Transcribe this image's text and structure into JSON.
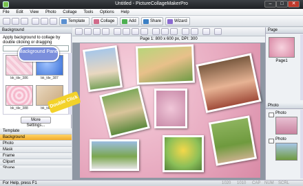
{
  "window": {
    "title": "Untitled - PictureCollageMakerPro",
    "min": "–",
    "max": "□",
    "close": "✕"
  },
  "menu": [
    "File",
    "Edit",
    "View",
    "Photo",
    "Collage",
    "Tools",
    "Options",
    "Help"
  ],
  "toolbar": {
    "template": "Template",
    "collage": "Collage",
    "add": "Add",
    "share": "Share",
    "wizard": "Wizard"
  },
  "left_panel": {
    "title": "Background",
    "description": "Apply background to collage by double clicking or dragging",
    "tiles": [
      "bk_tile_386",
      "bk_tile_387",
      "bk_tile_388",
      "bk_tile_389"
    ],
    "more_button": "More Settings...",
    "categories": [
      "Template",
      "Background",
      "Photo",
      "Mask",
      "Frame",
      "Clipart",
      "Shape"
    ],
    "selected_category": "Background"
  },
  "callouts": {
    "pane": "Background Pane",
    "double_click": "Double Click"
  },
  "canvas": {
    "info": "Page 1: 800 x 600 px, DPI: 300"
  },
  "right_panel": {
    "pages_title": "Page",
    "page_label": "Page1",
    "photos_title": "Photo",
    "photo_items": [
      "Photo",
      "Photo"
    ]
  },
  "status": {
    "text": "For Help, press F1",
    "indicators": [
      "1020",
      "1010",
      "CAP",
      "NUM",
      "SCRL"
    ]
  },
  "colors": {
    "accent": "#f2ab2a",
    "bubble": "#7b8fdc",
    "callout": "#f3d22a"
  }
}
